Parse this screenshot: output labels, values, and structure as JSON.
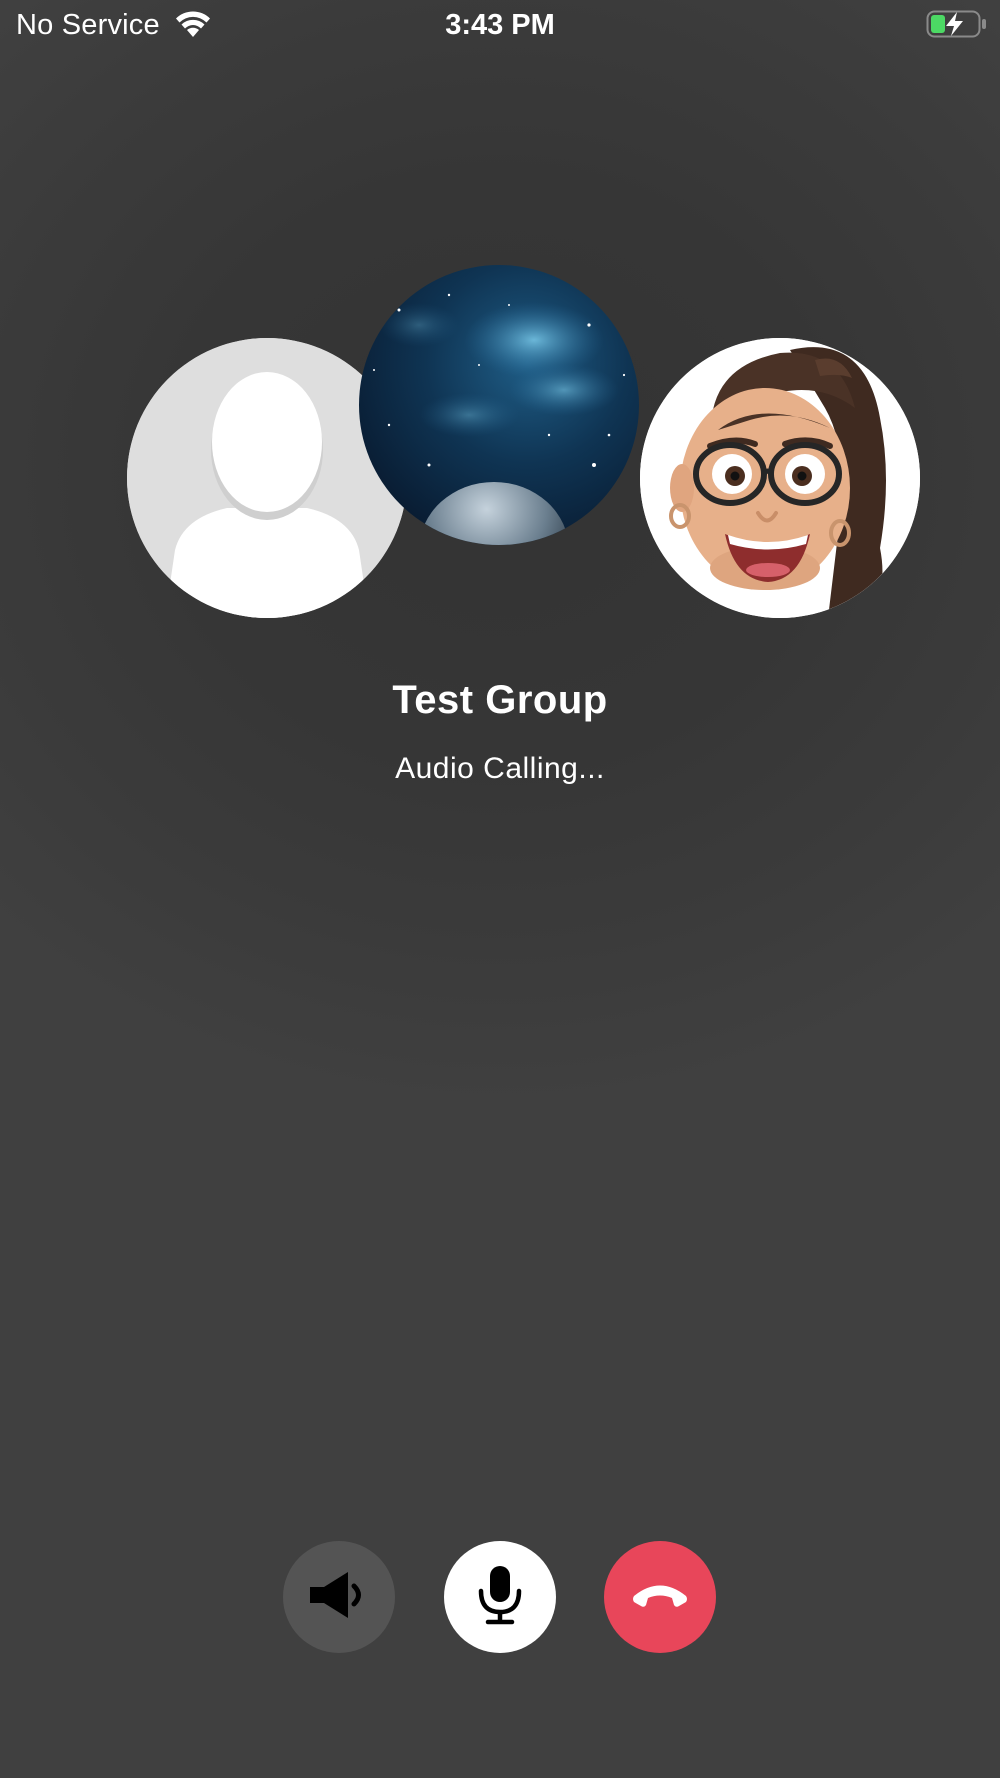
{
  "status_bar": {
    "carrier": "No Service",
    "time": "3:43 PM",
    "wifi_icon": "wifi-icon",
    "battery_icon": "battery-charging-icon",
    "battery_color": "#4cd964"
  },
  "call": {
    "title": "Test Group",
    "status": "Audio Calling...",
    "participants": [
      {
        "avatar": "default-person-avatar"
      },
      {
        "avatar": "space-nebula-avatar"
      },
      {
        "avatar": "memoji-avatar"
      }
    ]
  },
  "controls": [
    {
      "name": "speaker",
      "icon": "speaker-icon",
      "background": "#545454"
    },
    {
      "name": "mute",
      "icon": "microphone-icon",
      "background": "#ffffff"
    },
    {
      "name": "end-call",
      "icon": "hang-up-icon",
      "background": "#e8465a"
    }
  ]
}
